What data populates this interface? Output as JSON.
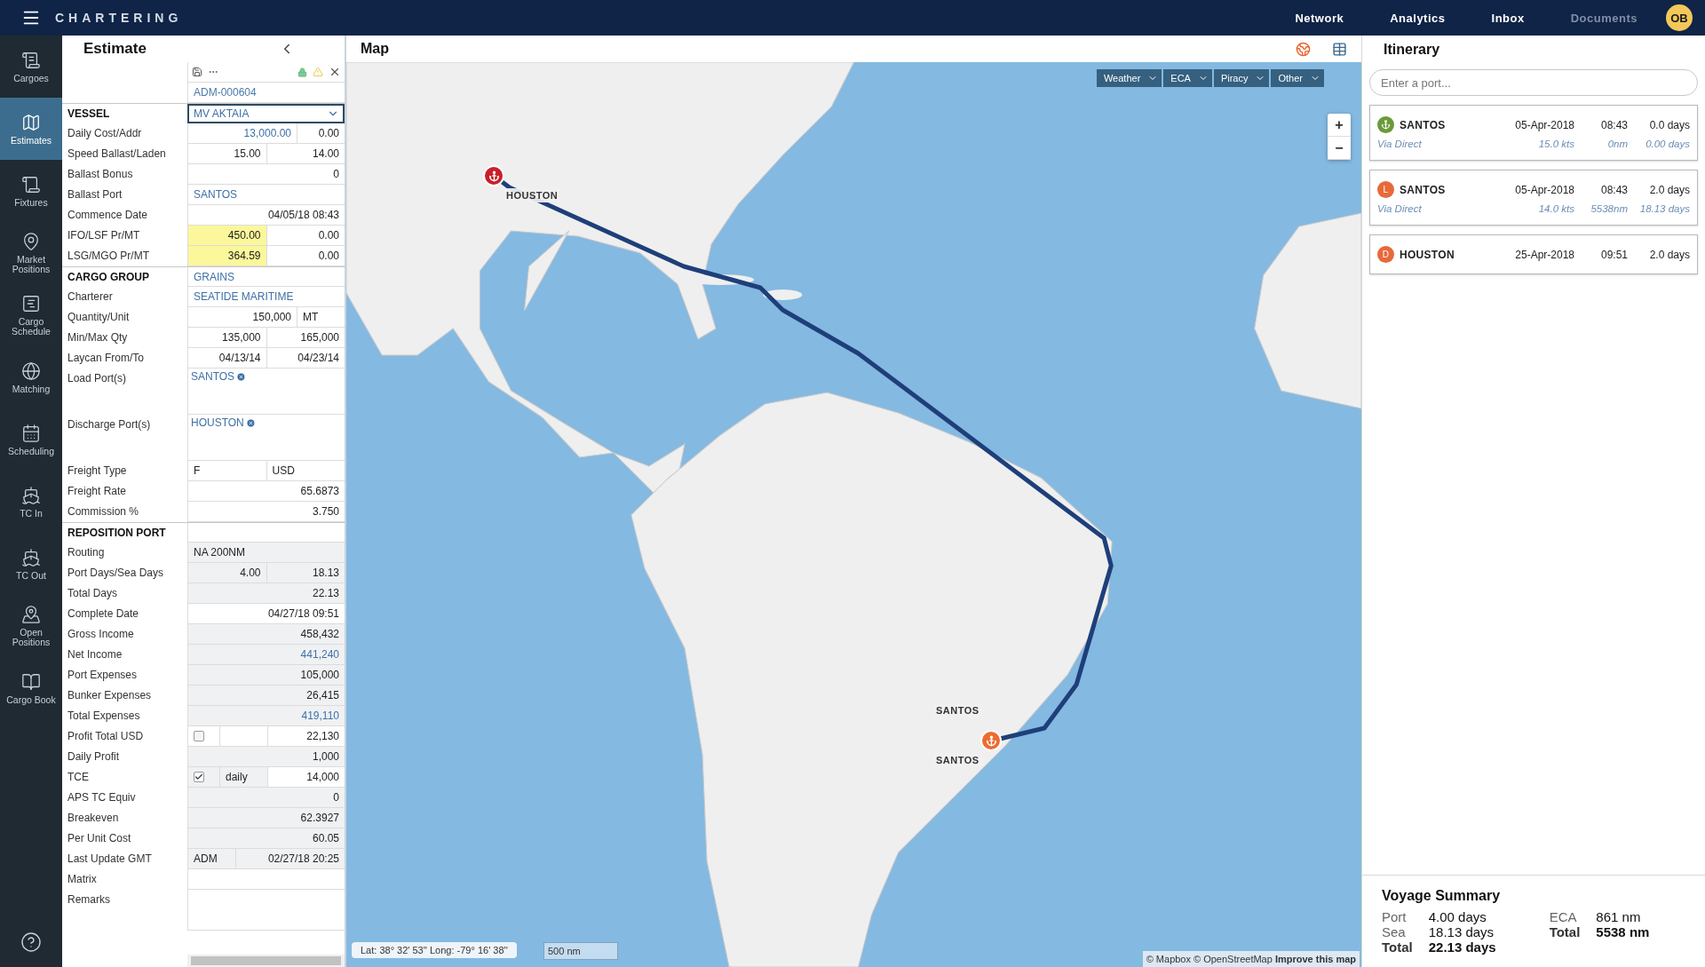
{
  "topbar": {
    "app_title": "CHARTERING",
    "nav": [
      {
        "label": "Network",
        "disabled": false
      },
      {
        "label": "Analytics",
        "disabled": false
      },
      {
        "label": "Inbox",
        "disabled": false
      },
      {
        "label": "Documents",
        "disabled": true
      }
    ],
    "avatar": "OB"
  },
  "sidebar": {
    "items": [
      {
        "label": "Cargoes",
        "selected": false
      },
      {
        "label": "Estimates",
        "selected": true
      },
      {
        "label": "Fixtures",
        "selected": false
      },
      {
        "label": "Market Positions",
        "selected": false
      },
      {
        "label": "Cargo Schedule",
        "selected": false
      },
      {
        "label": "Matching",
        "selected": false
      },
      {
        "label": "Scheduling",
        "selected": false
      },
      {
        "label": "TC In",
        "selected": false
      },
      {
        "label": "TC Out",
        "selected": false
      },
      {
        "label": "Open Positions",
        "selected": false
      },
      {
        "label": "Cargo Book",
        "selected": false
      }
    ]
  },
  "estimate": {
    "title": "Estimate",
    "record_id": "ADM-000604",
    "rows": [
      {
        "label": "VESSEL",
        "section": true,
        "cells": [
          {
            "kind": "select",
            "text": "MV AKTAIA",
            "link": true
          }
        ]
      },
      {
        "label": "Daily Cost/Addr",
        "cells": [
          {
            "kind": "number",
            "text": "13,000.00",
            "link": true
          },
          {
            "kind": "number",
            "text": "0.00",
            "narrow": true
          }
        ]
      },
      {
        "label": "Speed Ballast/Laden",
        "cells": [
          {
            "kind": "number",
            "text": "15.00"
          },
          {
            "kind": "number",
            "text": "14.00"
          }
        ]
      },
      {
        "label": "Ballast Bonus",
        "cells": [
          {
            "kind": "number",
            "text": "0"
          }
        ]
      },
      {
        "label": "Ballast Port",
        "cells": [
          {
            "kind": "text",
            "text": "SANTOS",
            "link": true
          }
        ]
      },
      {
        "label": "Commence Date",
        "cells": [
          {
            "kind": "number",
            "text": "04/05/18 08:43"
          }
        ]
      },
      {
        "label": "IFO/LSF Pr/MT",
        "cells": [
          {
            "kind": "number",
            "text": "450.00",
            "highlight": true
          },
          {
            "kind": "number",
            "text": "0.00"
          }
        ]
      },
      {
        "label": "LSG/MGO Pr/MT",
        "cells": [
          {
            "kind": "number",
            "text": "364.59",
            "highlight": true
          },
          {
            "kind": "number",
            "text": "0.00"
          }
        ]
      },
      {
        "label": "CARGO GROUP",
        "section": true,
        "cells": [
          {
            "kind": "text",
            "text": "GRAINS",
            "link": true
          }
        ]
      },
      {
        "label": "Charterer",
        "cells": [
          {
            "kind": "text",
            "text": "SEATIDE MARITIME",
            "link": true
          }
        ]
      },
      {
        "label": "Quantity/Unit",
        "cells": [
          {
            "kind": "number",
            "text": "150,000"
          },
          {
            "kind": "text",
            "text": "MT",
            "narrow": true
          }
        ]
      },
      {
        "label": "Min/Max Qty",
        "cells": [
          {
            "kind": "number",
            "text": "135,000"
          },
          {
            "kind": "number",
            "text": "165,000"
          }
        ]
      },
      {
        "label": "Laycan From/To",
        "cells": [
          {
            "kind": "number",
            "text": "04/13/14"
          },
          {
            "kind": "number",
            "text": "04/23/14"
          }
        ]
      },
      {
        "label": "Load Port(s)",
        "cells": [
          {
            "kind": "tag",
            "text": "SANTOS",
            "link": true
          }
        ]
      },
      {
        "label": "Discharge Port(s)",
        "cells": [
          {
            "kind": "tag",
            "text": "HOUSTON",
            "link": true
          }
        ]
      },
      {
        "label": "Freight Type",
        "cells": [
          {
            "kind": "text",
            "text": "F"
          },
          {
            "kind": "text",
            "text": "USD"
          }
        ]
      },
      {
        "label": "Freight Rate",
        "cells": [
          {
            "kind": "number",
            "text": "65.6873"
          }
        ]
      },
      {
        "label": "Commission %",
        "cells": [
          {
            "kind": "number",
            "text": "3.750"
          }
        ]
      },
      {
        "label": "REPOSITION PORT",
        "section": true,
        "cells": [
          {
            "kind": "blank"
          }
        ]
      },
      {
        "label": "Routing",
        "cells": [
          {
            "kind": "text",
            "text": "NA 200NM",
            "readonly": true
          }
        ]
      },
      {
        "label": "Port Days/Sea Days",
        "cells": [
          {
            "kind": "number",
            "text": "4.00",
            "readonly": true
          },
          {
            "kind": "number",
            "text": "18.13",
            "readonly": true
          }
        ]
      },
      {
        "label": "Total Days",
        "cells": [
          {
            "kind": "number",
            "text": "22.13",
            "readonly": true
          }
        ]
      },
      {
        "label": "Complete Date",
        "cells": [
          {
            "kind": "number",
            "text": "04/27/18 09:51"
          }
        ]
      },
      {
        "label": "Gross Income",
        "cells": [
          {
            "kind": "number",
            "text": "458,432",
            "readonly": true
          }
        ]
      },
      {
        "label": "Net Income",
        "cells": [
          {
            "kind": "number",
            "text": "441,240",
            "readonly": true,
            "link": true
          }
        ]
      },
      {
        "label": "Port Expenses",
        "cells": [
          {
            "kind": "number",
            "text": "105,000",
            "readonly": true
          }
        ]
      },
      {
        "label": "Bunker Expenses",
        "cells": [
          {
            "kind": "number",
            "text": "26,415",
            "readonly": true
          }
        ]
      },
      {
        "label": "Total Expenses",
        "cells": [
          {
            "kind": "number",
            "text": "419,110",
            "readonly": true,
            "link": true
          }
        ]
      },
      {
        "label": "Profit Total USD",
        "cells": [
          {
            "kind": "check",
            "checked": false
          },
          {
            "kind": "blank",
            "narrow": true
          },
          {
            "kind": "number",
            "text": "22,130"
          }
        ]
      },
      {
        "label": "Daily Profit",
        "cells": [
          {
            "kind": "number",
            "text": "1,000",
            "readonly": true
          }
        ]
      },
      {
        "label": "TCE",
        "cells": [
          {
            "kind": "check",
            "checked": true,
            "readonly": true
          },
          {
            "kind": "text",
            "text": "daily",
            "narrow": true,
            "readonly": true
          },
          {
            "kind": "number",
            "text": "14,000"
          }
        ]
      },
      {
        "label": "APS TC Equiv",
        "cells": [
          {
            "kind": "number",
            "text": "0",
            "readonly": true
          }
        ]
      },
      {
        "label": "Breakeven",
        "cells": [
          {
            "kind": "number",
            "text": "62.3927",
            "readonly": true
          }
        ]
      },
      {
        "label": "Per Unit Cost",
        "cells": [
          {
            "kind": "number",
            "text": "60.05",
            "readonly": true
          }
        ]
      },
      {
        "label": "Last Update GMT",
        "cells": [
          {
            "kind": "text",
            "text": "ADM",
            "narrow": true,
            "readonly": true
          },
          {
            "kind": "number",
            "text": "02/27/18 20:25",
            "readonly": true
          }
        ]
      },
      {
        "label": "Matrix",
        "cells": [
          {
            "kind": "blank"
          }
        ]
      },
      {
        "label": "Remarks",
        "cells": [
          {
            "kind": "notes"
          }
        ]
      }
    ]
  },
  "map": {
    "title": "Map",
    "layers": [
      "Weather",
      "ECA",
      "Piracy",
      "Other"
    ],
    "zoom": [
      "+",
      "−"
    ],
    "markers": [
      {
        "kind": "discharge",
        "labels": [
          "HOUSTON"
        ]
      },
      {
        "kind": "load",
        "labels": [
          "SANTOS",
          "SANTOS"
        ]
      }
    ],
    "coordinates": "Lat: 38° 32' 53'' Long: -79° 16' 38''",
    "scale": "500 nm",
    "attribution": "© Mapbox © OpenStreetMap",
    "attribution_link": "Improve this map"
  },
  "itinerary": {
    "title": "Itinerary",
    "search": {
      "placeholder": "Enter a port..."
    },
    "stops": [
      {
        "badge": {
          "kind": "anchor",
          "color": "#6a9a3a"
        },
        "port": "SANTOS",
        "date": "05-Apr-2018",
        "time": "08:43",
        "duration": "0.0 days",
        "route": "Via Direct",
        "speed": "15.0 kts",
        "distance": "0nm",
        "sea_days": "0.00 days"
      },
      {
        "badge": {
          "kind": "letter",
          "text": "L",
          "color": "#e8693a"
        },
        "port": "SANTOS",
        "date": "05-Apr-2018",
        "time": "08:43",
        "duration": "2.0 days",
        "route": "Via Direct",
        "speed": "14.0 kts",
        "distance": "5538nm",
        "sea_days": "18.13 days"
      },
      {
        "badge": {
          "kind": "letter",
          "text": "D",
          "color": "#e8693a"
        },
        "port": "HOUSTON",
        "date": "25-Apr-2018",
        "time": "09:51",
        "duration": "2.0 days"
      }
    ]
  },
  "voyage_summary": {
    "title": "Voyage Summary",
    "left": [
      {
        "label": "Port",
        "value": "4.00 days",
        "bold": false
      },
      {
        "label": "Sea",
        "value": "18.13 days",
        "bold": false
      },
      {
        "label": "Total",
        "value": "22.13 days",
        "bold": true
      }
    ],
    "right": [
      {
        "label": "ECA",
        "value": "861 nm",
        "bold": false
      },
      {
        "label": "Total",
        "value": "5538 nm",
        "bold": true
      }
    ]
  }
}
